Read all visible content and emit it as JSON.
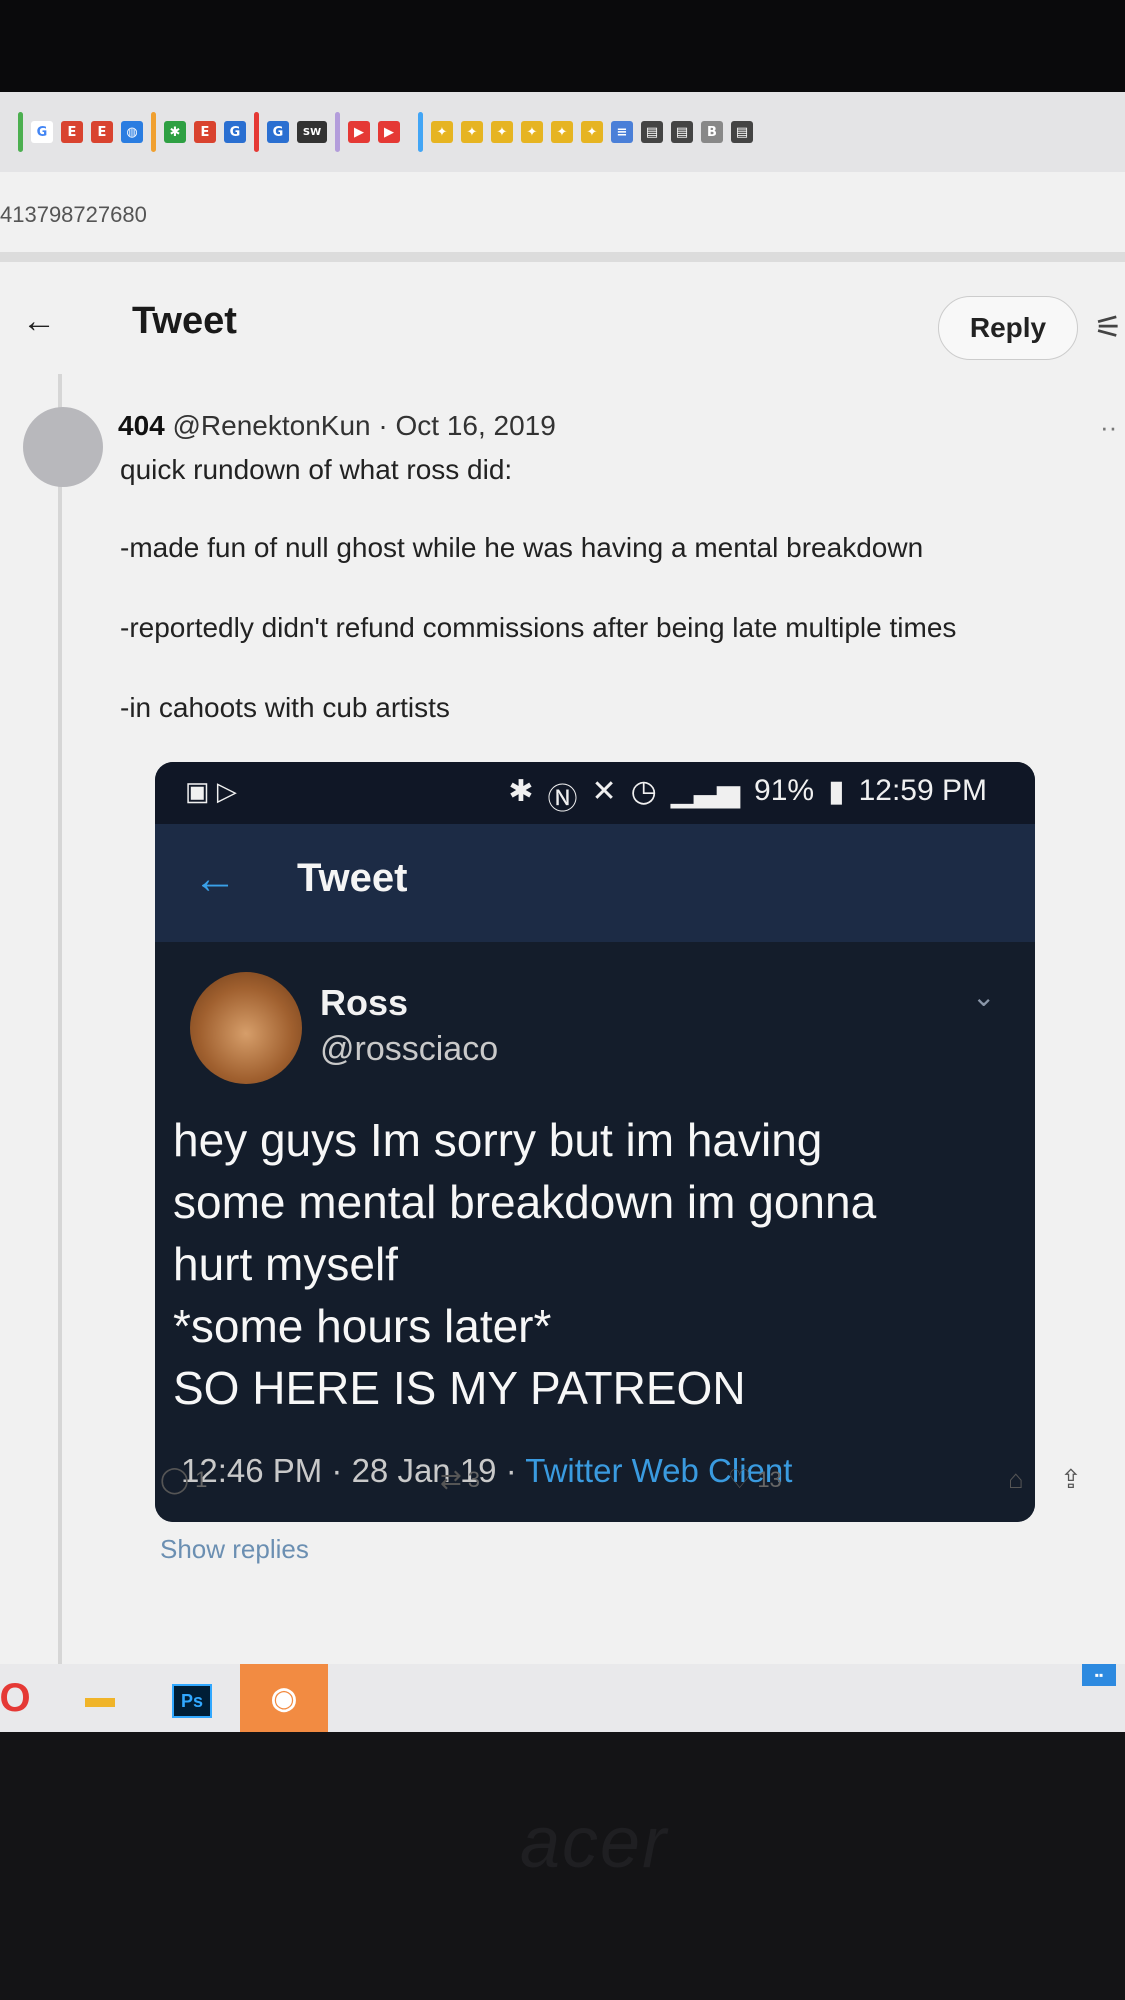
{
  "browser": {
    "bookmark_letters": [
      "G",
      "E",
      "E",
      "E",
      "G",
      "SW",
      "B"
    ],
    "url_fragment": "413798727680"
  },
  "header": {
    "title": "Tweet",
    "reply_label": "Reply"
  },
  "tweet": {
    "author_name": "404",
    "author_handle": "@RenektonKun",
    "date": "Oct 16, 2019",
    "lines": [
      "quick rundown of what ross did:",
      "-made fun of null ghost while he was having a mental breakdown",
      "-reportedly didn't refund commissions after being late multiple times",
      "-in cahoots with cub artists"
    ],
    "replies_count": "1",
    "retweets_count": "3",
    "likes_count": "13",
    "show_replies": "Show replies"
  },
  "embedded": {
    "status_battery": "91%",
    "status_time": "12:59 PM",
    "header_title": "Tweet",
    "author_name": "Ross",
    "author_handle": "@rossciaco",
    "text_lines": [
      "hey guys Im sorry but im having",
      "some mental breakdown im gonna",
      "hurt myself",
      "*some hours later*",
      "SO HERE IS MY PATREON"
    ],
    "meta_time": "12:46 PM · 28 Jan 19 · ",
    "meta_client": "Twitter Web Client"
  },
  "taskbar": {
    "ps_label": "Ps"
  },
  "colors": {
    "link_blue": "#3a9be0",
    "embed_bg": "#141d2b",
    "embed_header": "#1c2b45"
  }
}
